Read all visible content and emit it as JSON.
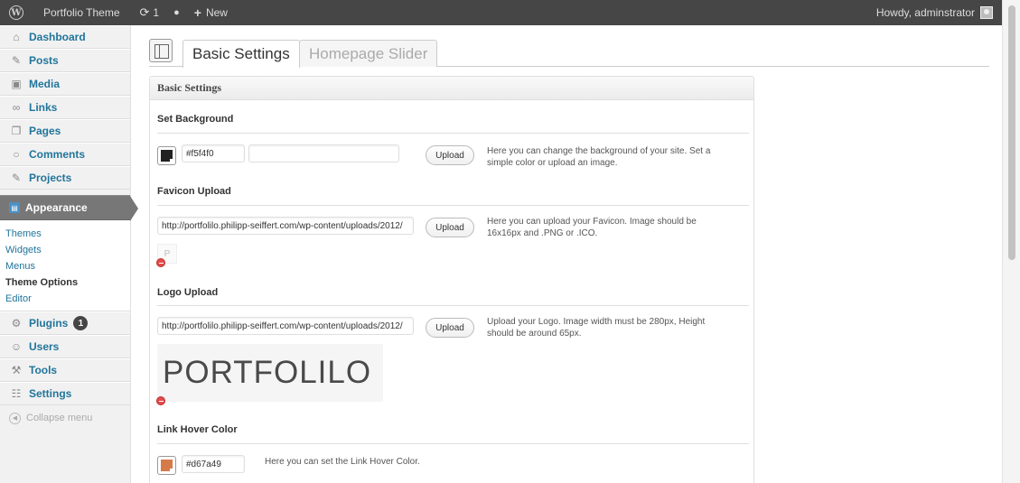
{
  "adminbar": {
    "site_name": "Portfolio Theme",
    "updates_count": "1",
    "new_label": "New",
    "howdy": "Howdy, adminstrator"
  },
  "sidebar": {
    "items": [
      {
        "label": "Dashboard",
        "icon": "home-icon"
      },
      {
        "label": "Posts",
        "icon": "pin-icon"
      },
      {
        "label": "Media",
        "icon": "media-icon"
      },
      {
        "label": "Links",
        "icon": "link-icon"
      },
      {
        "label": "Pages",
        "icon": "pages-icon"
      },
      {
        "label": "Comments",
        "icon": "comment-icon"
      },
      {
        "label": "Projects",
        "icon": "pin-icon"
      },
      {
        "label": "Appearance",
        "icon": "appearance-icon"
      },
      {
        "label": "Plugins",
        "icon": "plugin-icon",
        "badge": "1"
      },
      {
        "label": "Users",
        "icon": "users-icon"
      },
      {
        "label": "Tools",
        "icon": "tools-icon"
      },
      {
        "label": "Settings",
        "icon": "settings-icon"
      }
    ],
    "submenu": [
      "Themes",
      "Widgets",
      "Menus",
      "Theme Options",
      "Editor"
    ],
    "collapse": "Collapse menu"
  },
  "tabs": {
    "basic": "Basic Settings",
    "slider": "Homepage Slider"
  },
  "panel": {
    "title": "Basic Settings",
    "background": {
      "title": "Set Background",
      "color_value": "#f5f4f0",
      "swatch_color": "#222222",
      "upload_label": "Upload",
      "desc": "Here you can change the background of your site. Set a simple color or upload an image."
    },
    "favicon": {
      "title": "Favicon Upload",
      "url": "http://portfolilo.philipp-seiffert.com/wp-content/uploads/2012/",
      "upload_label": "Upload",
      "desc": "Here you can upload your Favicon. Image should be 16x16px and .PNG or .ICO.",
      "preview_letter": "P"
    },
    "logo": {
      "title": "Logo Upload",
      "url": "http://portfolilo.philipp-seiffert.com/wp-content/uploads/2012/",
      "upload_label": "Upload",
      "desc": "Upload your Logo. Image width must be 280px, Height should be around 65px.",
      "preview_text": "PORTFOLILO"
    },
    "hover": {
      "title": "Link Hover Color",
      "color_value": "#d67a49",
      "swatch_color": "#d67a49",
      "desc": "Here you can set the Link Hover Color."
    }
  }
}
